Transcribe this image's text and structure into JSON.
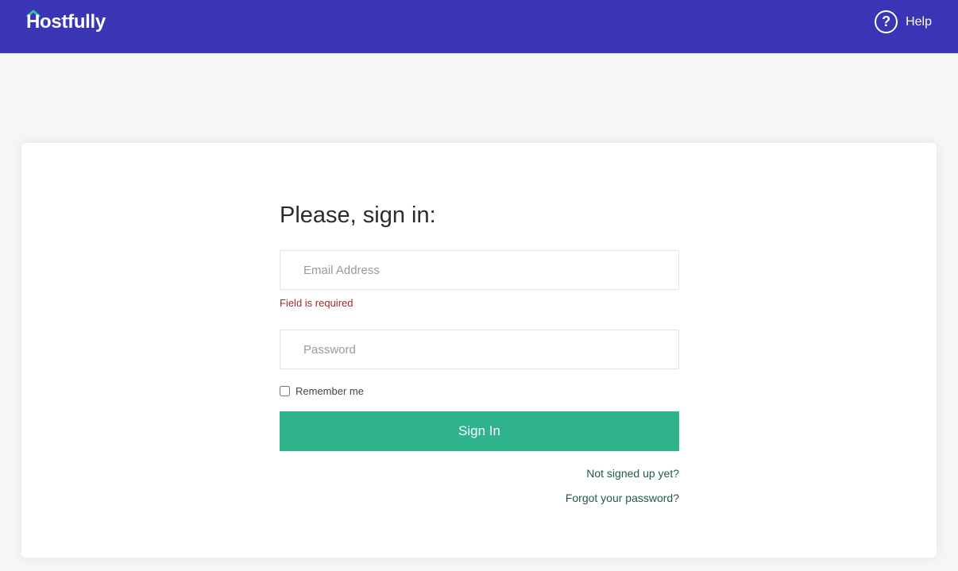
{
  "header": {
    "brand": "Hostfully",
    "help_label": "Help",
    "help_icon": "question-circle-icon",
    "bg_color": "#3a35b5",
    "logo_accent": "#34c3a0"
  },
  "login": {
    "title": "Please, sign in:",
    "email_placeholder": "Email Address",
    "email_value": "",
    "email_error": "Field is required",
    "password_placeholder": "Password",
    "password_value": "",
    "remember_label": "Remember me",
    "remember_checked": false,
    "submit_label": "Sign In",
    "submit_color": "#2fb38a",
    "signup_link": "Not signed up yet?",
    "forgot_link": "Forgot your password?"
  }
}
